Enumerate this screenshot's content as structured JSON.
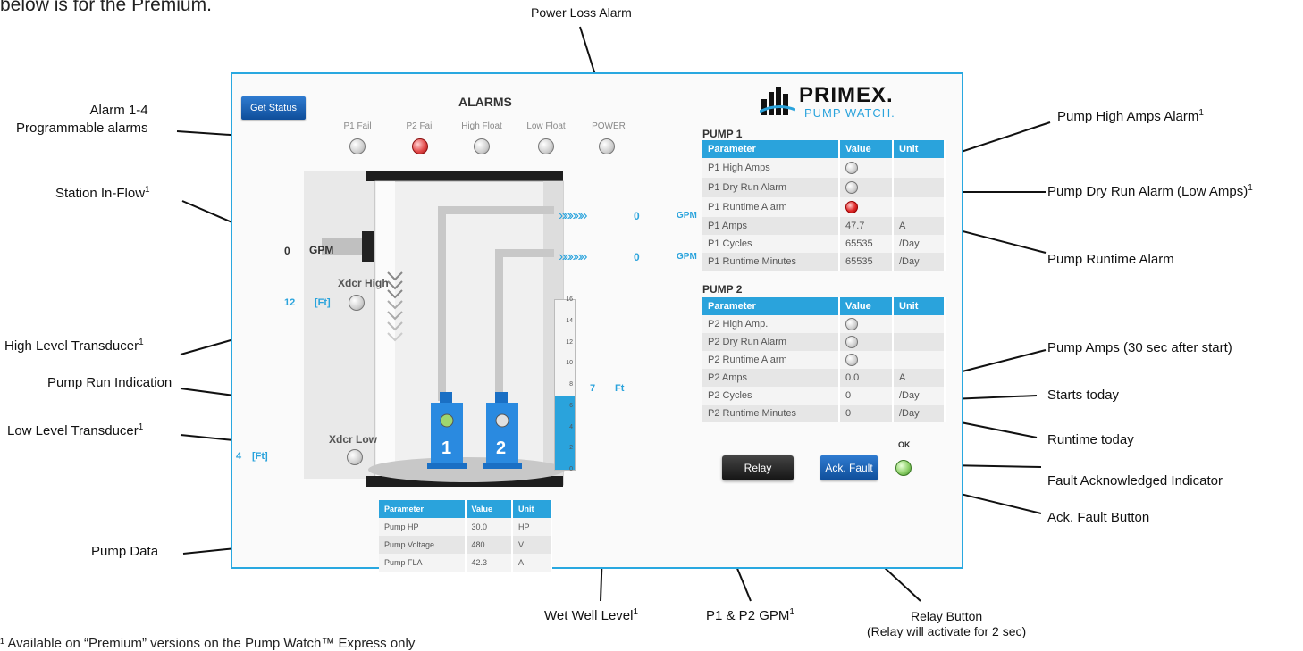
{
  "intro_text": "below is for the Premium.",
  "footnote": "¹ Available on “Premium” versions on the Pump Watch™ Express only",
  "panel": {
    "get_status": "Get Status",
    "alarms_title": "ALARMS",
    "alarm_labels": [
      "P1 Fail",
      "P2 Fail",
      "High Float",
      "Low Float",
      "POWER"
    ],
    "brand_name": "PRIMEX.",
    "brand_sub": "PUMP WATCH.",
    "inflow_value": "0",
    "inflow_unit": "GPM",
    "p1_gpm_value": "0",
    "p2_gpm_value": "0",
    "gpm_unit": "GPM",
    "xdcr_high_label": "Xdcr High",
    "xdcr_high_value": "12",
    "xdcr_high_unit": "[Ft]",
    "xdcr_low_label": "Xdcr Low",
    "xdcr_low_value": "4",
    "xdcr_low_unit": "[Ft]",
    "wet_well_value": "7",
    "wet_well_unit": "Ft",
    "scale_ticks": [
      "16",
      "14",
      "12",
      "10",
      "8",
      "6",
      "4",
      "2",
      "0"
    ],
    "wet_well_level": 7,
    "scale_max": 16,
    "pump1_number": "1",
    "pump2_number": "2",
    "pump1": {
      "title": "PUMP 1",
      "headers": [
        "Parameter",
        "Value",
        "Unit"
      ],
      "rows": [
        {
          "param": "P1 High Amps",
          "value": "",
          "unit": "",
          "led": "off"
        },
        {
          "param": "P1 Dry Run Alarm",
          "value": "",
          "unit": "",
          "led": "off"
        },
        {
          "param": "P1 Runtime Alarm",
          "value": "",
          "unit": "",
          "led": "red"
        },
        {
          "param": "P1 Amps",
          "value": "47.7",
          "unit": "A",
          "led": ""
        },
        {
          "param": "P1 Cycles",
          "value": "65535",
          "unit": "/Day",
          "led": ""
        },
        {
          "param": "P1 Runtime Minutes",
          "value": "65535",
          "unit": "/Day",
          "led": ""
        }
      ]
    },
    "pump2": {
      "title": "PUMP 2",
      "headers": [
        "Parameter",
        "Value",
        "Unit"
      ],
      "rows": [
        {
          "param": "P2 High Amp.",
          "value": "",
          "unit": "",
          "led": "off"
        },
        {
          "param": "P2 Dry Run Alarm",
          "value": "",
          "unit": "",
          "led": "off"
        },
        {
          "param": "P2 Runtime Alarm",
          "value": "",
          "unit": "",
          "led": "off"
        },
        {
          "param": "P2 Amps",
          "value": "0.0",
          "unit": "A",
          "led": ""
        },
        {
          "param": "P2 Cycles",
          "value": "0",
          "unit": "/Day",
          "led": ""
        },
        {
          "param": "P2 Runtime Minutes",
          "value": "0",
          "unit": "/Day",
          "led": ""
        }
      ]
    },
    "pump_data": {
      "headers": [
        "Parameter",
        "Value",
        "Unit"
      ],
      "rows": [
        {
          "param": "Pump HP",
          "value": "30.0",
          "unit": "HP"
        },
        {
          "param": "Pump Voltage",
          "value": "480",
          "unit": "V"
        },
        {
          "param": "Pump FLA",
          "value": "42.3",
          "unit": "A"
        }
      ]
    },
    "relay": "Relay",
    "ack_fault": "Ack. Fault",
    "ok": "OK"
  },
  "callouts": {
    "power_loss": "Power Loss Alarm",
    "alarm_programmable": "Alarm 1-4\nProgrammable alarms",
    "station_inflow": "Station In-Flow",
    "high_level": "High Level Transducer",
    "pump_run": "Pump Run Indication",
    "low_level": "Low Level Transducer",
    "pump_data": "Pump Data",
    "wet_well": "Wet Well Level",
    "p1p2_gpm": "P1 & P2 GPM",
    "relay_button": "Relay Button",
    "relay_note": "(Relay will activate for 2 sec)",
    "high_amps": "Pump High Amps Alarm",
    "dry_run": "Pump Dry Run Alarm (Low Amps)",
    "runtime_alarm": "Pump Runtime Alarm",
    "pump_amps": "Pump Amps (30 sec after start)",
    "starts_today": "Starts today",
    "runtime_today": "Runtime today",
    "fault_ack": "Fault Acknowledged Indicator",
    "ack_button": "Ack. Fault Button",
    "superscript": "1"
  }
}
